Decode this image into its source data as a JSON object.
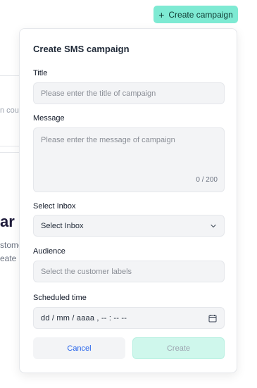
{
  "header": {
    "create_campaign_label": "Create campaign",
    "create_icon": "plus-icon"
  },
  "background": {
    "coupon_fragment": "n coup",
    "heading_fragment": "ar",
    "line1_fragment": "stome",
    "line2_fragment": "eate"
  },
  "form": {
    "title": "Create SMS campaign",
    "fields": {
      "title": {
        "label": "Title",
        "placeholder": "Please enter the title of campaign"
      },
      "message": {
        "label": "Message",
        "placeholder": "Please enter the message of campaign",
        "counter": "0 / 200"
      },
      "inbox": {
        "label": "Select Inbox",
        "value": "Select Inbox",
        "icon": "chevron-down-icon"
      },
      "audience": {
        "label": "Audience",
        "placeholder": "Select the customer labels"
      },
      "scheduled_time": {
        "label": "Scheduled time",
        "value": "dd / mm / aaaa ,  -- : --   --",
        "icon": "calendar-icon"
      }
    },
    "actions": {
      "cancel_label": "Cancel",
      "create_label": "Create"
    }
  },
  "colors": {
    "accent": "#7eead3",
    "accent_disabled": "#cff7ec",
    "link": "#2563eb",
    "field_bg": "#f3f4f6"
  }
}
